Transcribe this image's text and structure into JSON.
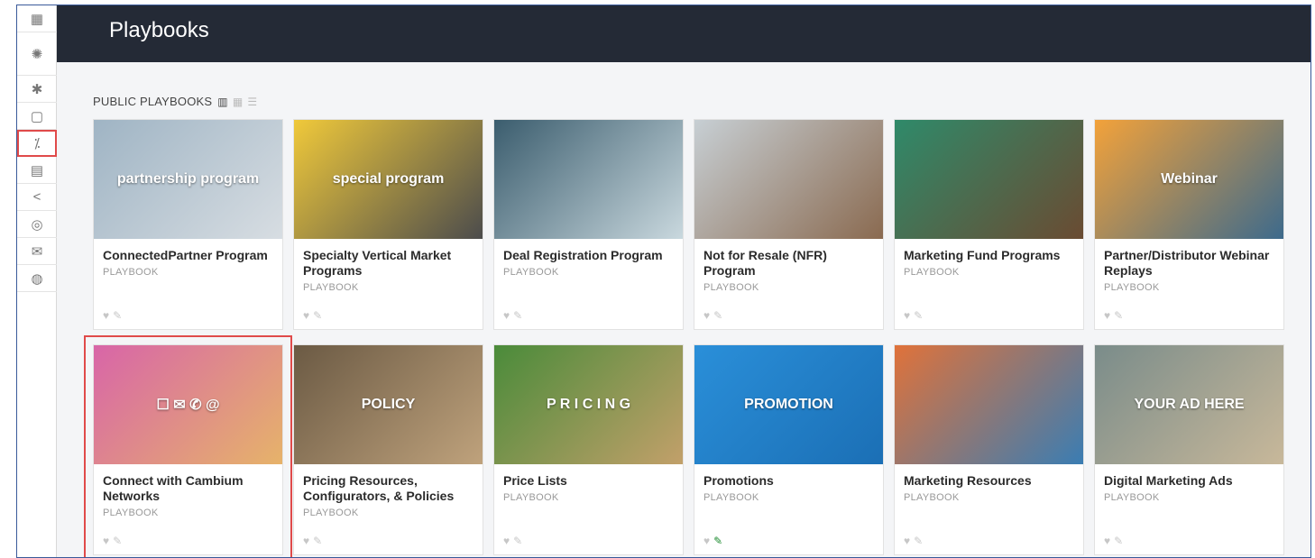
{
  "header": {
    "title": "Playbooks"
  },
  "section": {
    "title": "PUBLIC PLAYBOOKS"
  },
  "sidebar": {
    "items": [
      {
        "icon": "dashboard-icon",
        "glyph": "▦"
      },
      {
        "icon": "megaphone-icon",
        "glyph": "✺"
      },
      {
        "icon": "lightbulb-icon",
        "glyph": "✱"
      },
      {
        "icon": "chat-icon",
        "glyph": "▢"
      },
      {
        "icon": "playbook-icon",
        "glyph": "⁒"
      },
      {
        "icon": "calendar-icon",
        "glyph": "▤"
      },
      {
        "icon": "share-icon",
        "glyph": "<"
      },
      {
        "icon": "handshake-icon",
        "glyph": "◎"
      },
      {
        "icon": "mail-icon",
        "glyph": "✉"
      },
      {
        "icon": "search-settings-icon",
        "glyph": "◍"
      }
    ]
  },
  "cards": [
    {
      "title": "ConnectedPartner Program",
      "type": "PLAYBOOK",
      "thumb_text": "partnership program",
      "colors": [
        "#9fb4c4",
        "#d7dde2"
      ],
      "pinned": false
    },
    {
      "title": "Specialty Vertical Market Programs",
      "type": "PLAYBOOK",
      "thumb_text": "special program",
      "colors": [
        "#f0c93a",
        "#4c4c4c"
      ],
      "pinned": false
    },
    {
      "title": "Deal Registration Program",
      "type": "PLAYBOOK",
      "thumb_text": "",
      "colors": [
        "#3b5d6e",
        "#c9d8de"
      ],
      "pinned": false
    },
    {
      "title": "Not for Resale (NFR) Program",
      "type": "PLAYBOOK",
      "thumb_text": "",
      "colors": [
        "#c7cfd4",
        "#8a6a50"
      ],
      "pinned": false
    },
    {
      "title": "Marketing Fund Programs",
      "type": "PLAYBOOK",
      "thumb_text": "",
      "colors": [
        "#2f8a6a",
        "#6a4b32"
      ],
      "pinned": false
    },
    {
      "title": "Partner/Distributor Webinar Replays",
      "type": "PLAYBOOK",
      "thumb_text": "Webinar",
      "colors": [
        "#f3a23a",
        "#3d6a8c"
      ],
      "pinned": false
    },
    {
      "title": "Connect with Cambium Networks",
      "type": "PLAYBOOK",
      "thumb_text": "☐ ✉ ✆ @",
      "colors": [
        "#d865a8",
        "#e6b36a"
      ],
      "pinned": false,
      "highlight": true
    },
    {
      "title": "Pricing Resources, Configurators, & Policies",
      "type": "PLAYBOOK",
      "thumb_text": "POLICY",
      "colors": [
        "#6b5a44",
        "#bfa27c"
      ],
      "pinned": false
    },
    {
      "title": "Price Lists",
      "type": "PLAYBOOK",
      "thumb_text": "P R I C I N G",
      "colors": [
        "#4a8b3a",
        "#c2a06a"
      ],
      "pinned": false
    },
    {
      "title": "Promotions",
      "type": "PLAYBOOK",
      "thumb_text": "PROMOTION",
      "colors": [
        "#2a8fd9",
        "#1b6fb5"
      ],
      "pinned": true
    },
    {
      "title": "Marketing Resources",
      "type": "PLAYBOOK",
      "thumb_text": "",
      "colors": [
        "#e0723a",
        "#3a7db3"
      ],
      "pinned": false
    },
    {
      "title": "Digital Marketing Ads",
      "type": "PLAYBOOK",
      "thumb_text": "YOUR AD HERE",
      "colors": [
        "#7a8c8a",
        "#c8b89a"
      ],
      "pinned": false
    }
  ]
}
